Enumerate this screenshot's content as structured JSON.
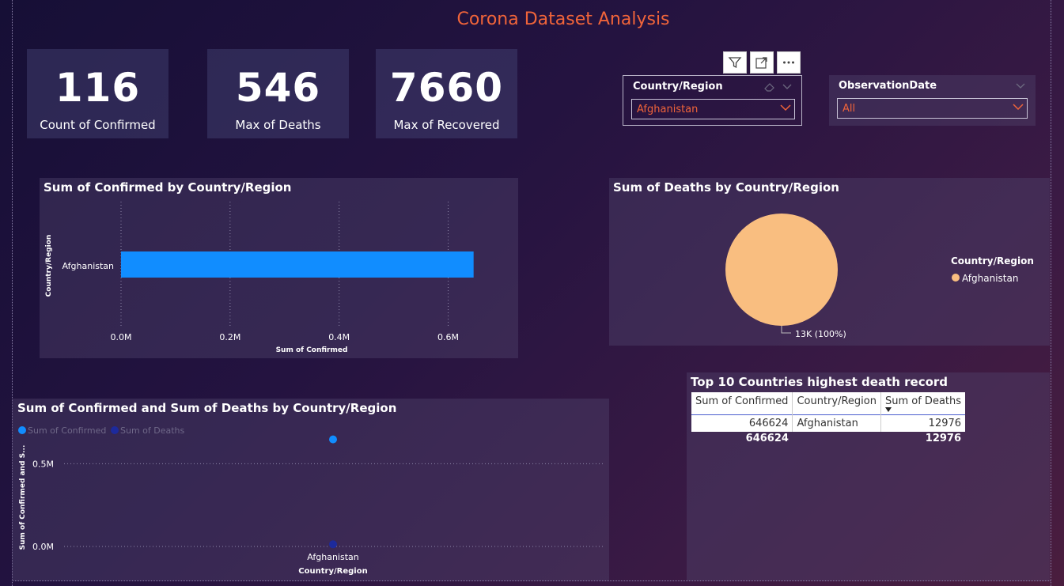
{
  "page_title": "Corona Dataset Analysis",
  "colors": {
    "accent": "#f0643a",
    "bar": "#118dff",
    "pie": "#f9be80",
    "deaths_series": "#1d2a9c"
  },
  "cards": [
    {
      "value": "116",
      "label": "Count of Confirmed"
    },
    {
      "value": "546",
      "label": "Max of Deaths"
    },
    {
      "value": "7660",
      "label": "Max of Recovered"
    }
  ],
  "toolbar": {
    "icons": [
      "filter-icon",
      "focus-mode-icon",
      "more-options-icon"
    ]
  },
  "slicers": {
    "country": {
      "title": "Country/Region",
      "value": "Afghanistan"
    },
    "date": {
      "title": "ObservationDate",
      "value": "All"
    }
  },
  "bar_chart": {
    "title": "Sum of Confirmed by Country/Region",
    "ylabel": "Country/Region",
    "xlabel": "Sum of Confirmed",
    "category": "Afghanistan",
    "ticks": [
      "0.0M",
      "0.2M",
      "0.4M",
      "0.6M"
    ]
  },
  "pie_chart": {
    "title": "Sum of Deaths by Country/Region",
    "legend_title": "Country/Region",
    "legend_item": "Afghanistan",
    "data_label": "13K (100%)"
  },
  "scatter_chart": {
    "title": "Sum of Confirmed and Sum of Deaths by Country/Region",
    "legend": [
      "Sum of Confirmed",
      "Sum of Deaths"
    ],
    "ylabel": "Sum of Confirmed and S...",
    "xlabel": "Country/Region",
    "category": "Afghanistan",
    "ticks": [
      "0.0M",
      "0.5M"
    ]
  },
  "table_visual": {
    "title": "Top 10 Countries highest death record",
    "columns": [
      "Sum of Confirmed",
      "Country/Region",
      "Sum of Deaths"
    ],
    "rows": [
      [
        "646624",
        "Afghanistan",
        "12976"
      ]
    ],
    "totals": [
      "646624",
      "",
      "12976"
    ]
  },
  "chart_data": [
    {
      "type": "bar",
      "title": "Sum of Confirmed by Country/Region",
      "categories": [
        "Afghanistan"
      ],
      "values": [
        646624
      ],
      "xlabel": "Sum of Confirmed",
      "ylabel": "Country/Region",
      "xlim": [
        0,
        650000
      ],
      "grid": true
    },
    {
      "type": "pie",
      "title": "Sum of Deaths by Country/Region",
      "categories": [
        "Afghanistan"
      ],
      "values": [
        12976
      ],
      "legend": "right"
    },
    {
      "type": "scatter",
      "title": "Sum of Confirmed and Sum of Deaths by Country/Region",
      "categories": [
        "Afghanistan"
      ],
      "series": [
        {
          "name": "Sum of Confirmed",
          "values": [
            646624
          ]
        },
        {
          "name": "Sum of Deaths",
          "values": [
            12976
          ]
        }
      ],
      "xlabel": "Country/Region",
      "ylabel": "Sum of Confirmed and S...",
      "ylim": [
        0,
        750000
      ],
      "legend": "top-left",
      "grid": true
    }
  ]
}
